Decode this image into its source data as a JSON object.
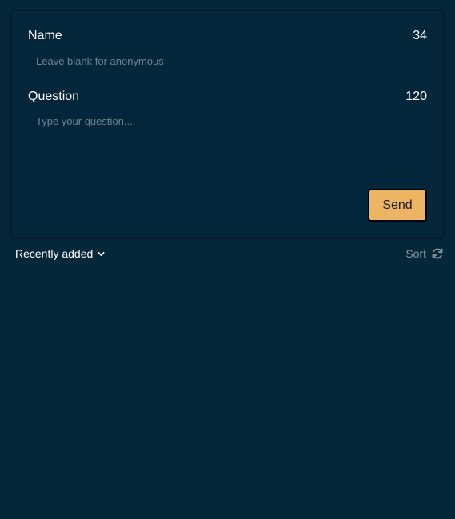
{
  "form": {
    "name": {
      "label": "Name",
      "counter": "34",
      "placeholder": "Leave blank for anonymous",
      "value": ""
    },
    "question": {
      "label": "Question",
      "counter": "120",
      "placeholder": "Type your question...",
      "value": ""
    },
    "send_label": "Send"
  },
  "sort_bar": {
    "order_label": "Recently added",
    "order_icon": "chevron-down-icon",
    "sort_label": "Sort",
    "sort_icon": "refresh-icon"
  },
  "colors": {
    "background": "#05273a",
    "card": "#03263a",
    "send_button": "#edb563",
    "muted_text": "#8a9aa3"
  }
}
